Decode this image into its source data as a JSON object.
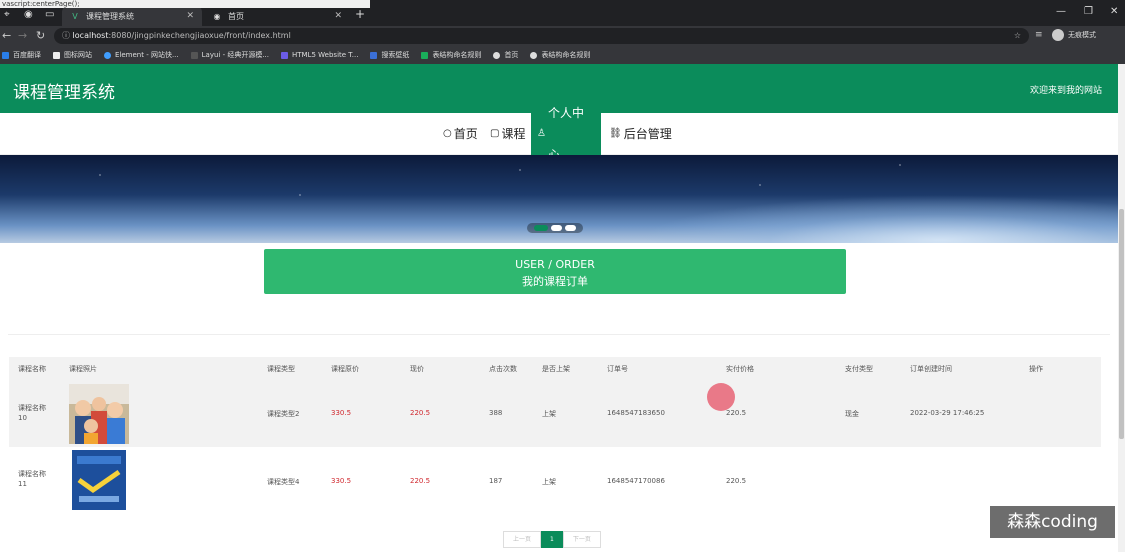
{
  "status_tip": "vascript:centerPage();",
  "browser": {
    "tabs": [
      {
        "title": "课程管理系统",
        "icon": "vue-icon"
      },
      {
        "title": "首页",
        "icon": "globe-icon"
      }
    ],
    "url_host": "localhost",
    "url_rest": ":8080/jingpinkechengjiaoxue/front/index.html",
    "incognito_label": "无痕模式",
    "bookmarks": [
      "百度翻译",
      "图标网站",
      "Element - 网站快...",
      "Layui - 经典开源模...",
      "HTML5 Website T...",
      "搜索壁纸",
      "表结构命名规则",
      "首页",
      "表结构命名规则"
    ]
  },
  "header": {
    "title": "课程管理系统",
    "welcome": "欢迎来到我的网站"
  },
  "nav": [
    {
      "label": "首页",
      "icon": "○"
    },
    {
      "label": "课程",
      "icon": "▢"
    },
    {
      "label": "个人中心",
      "icon": "♙"
    },
    {
      "label": "后台管理",
      "icon": "⛓"
    }
  ],
  "section": {
    "title_en": "USER / ORDER",
    "title_cn": "我的课程订单"
  },
  "table": {
    "headers": [
      "课程名称",
      "课程照片",
      "课程类型",
      "课程原价",
      "现价",
      "点击次数",
      "是否上架",
      "订单号",
      "实付价格",
      "支付类型",
      "订单创建时间",
      "操作"
    ],
    "rows": [
      {
        "name_line1": "课程名称",
        "name_line2": "10",
        "type": "课程类型2",
        "original_price": "330.5",
        "price": "220.5",
        "clicks": "388",
        "on_shelf": "上架",
        "order_no": "1648547183650",
        "paid": "220.5",
        "pay_type": "现金",
        "created": "2022-03-29 17:46:25"
      },
      {
        "name_line1": "课程名称",
        "name_line2": "11",
        "type": "课程类型4",
        "original_price": "330.5",
        "price": "220.5",
        "clicks": "187",
        "on_shelf": "上架",
        "order_no": "1648547170086",
        "paid": "220.5",
        "pay_type": "",
        "created": ""
      }
    ]
  },
  "pager": {
    "prev": "上一页",
    "current": "1",
    "next": "下一页"
  },
  "watermark": "森森coding",
  "colors": {
    "brand": "#0b8c5b",
    "section": "#2fb870",
    "price_red": "#d0282e"
  }
}
